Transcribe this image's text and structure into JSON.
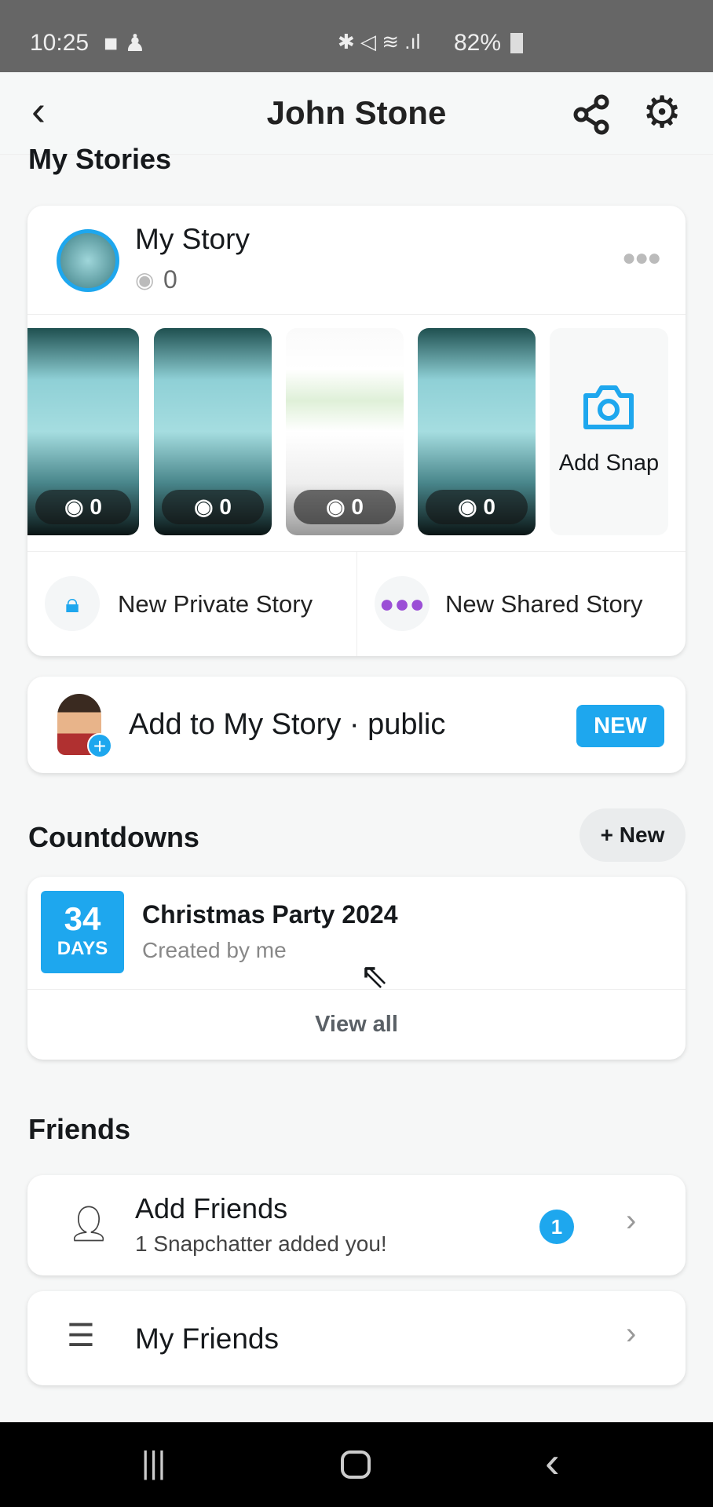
{
  "status_bar": {
    "time": "10:25",
    "battery": "82%"
  },
  "header": {
    "title": "John Stone"
  },
  "my_stories": {
    "section_title": "My Stories",
    "story_name": "My Story",
    "view_count": "0",
    "thumbnails": [
      {
        "views": "0"
      },
      {
        "views": "0"
      },
      {
        "views": "0"
      },
      {
        "views": "0"
      }
    ],
    "add_snap": "Add Snap",
    "new_private": "New Private Story",
    "new_shared": "New Shared Story"
  },
  "public_story": {
    "label": "Add to My Story · public",
    "badge": "NEW"
  },
  "countdowns": {
    "title": "Countdowns",
    "new_button": "+ New",
    "item": {
      "days": "34",
      "days_label": "DAYS",
      "name": "Christmas Party 2024",
      "subtitle": "Created by me"
    },
    "view_all": "View all"
  },
  "friends": {
    "title": "Friends",
    "add_friends": "Add Friends",
    "add_friends_sub": "1 Snapchatter added you!",
    "badge_count": "1",
    "my_friends": "My Friends"
  },
  "colors": {
    "accent": "#1ea7ee",
    "shared_purple": "#9b4fd6"
  }
}
